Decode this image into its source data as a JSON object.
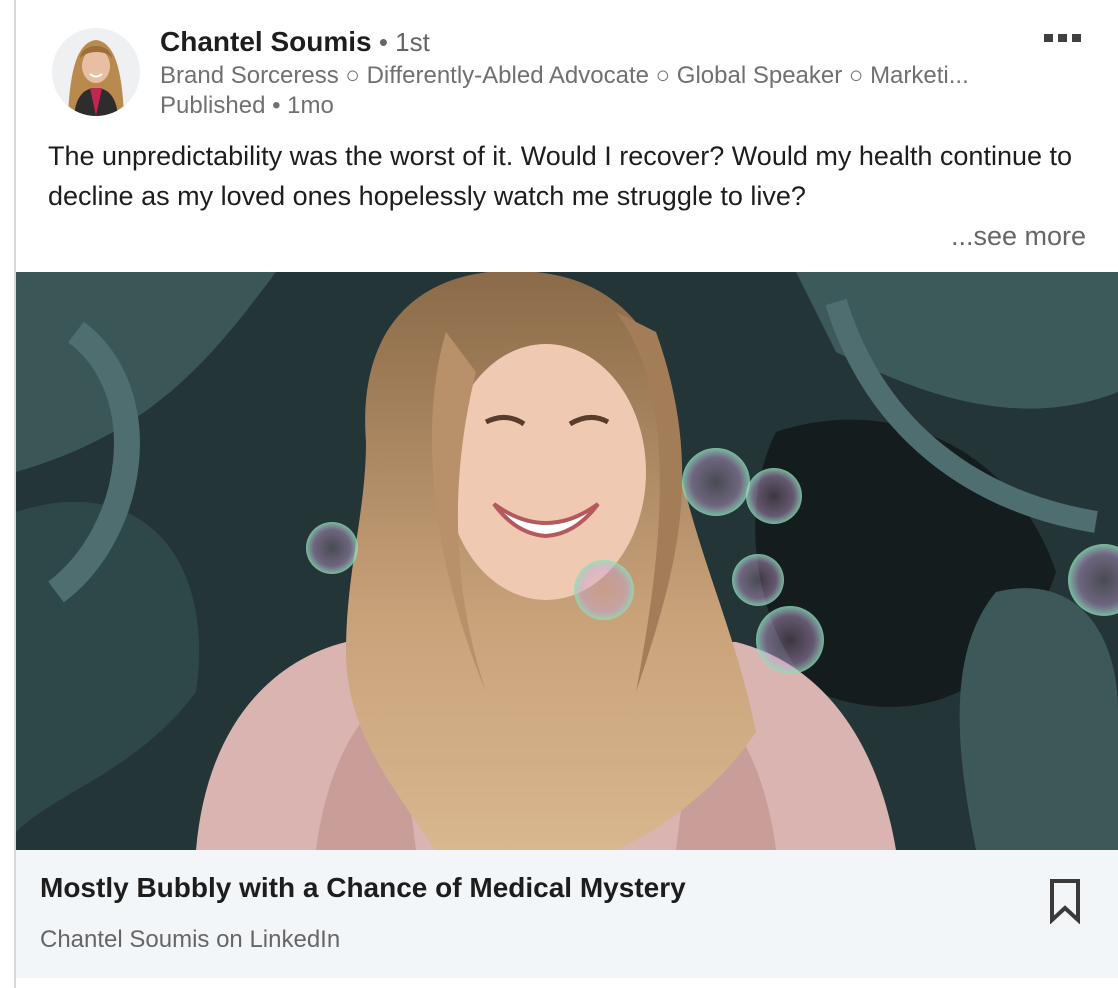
{
  "post": {
    "author_name": "Chantel Soumis",
    "degree": " • 1st",
    "headline": "Brand Sorceress ○ Differently-Abled Advocate ○ Global Speaker ○ Marketi...",
    "meta": "Published • 1mo",
    "text": "The unpredictability was the worst of it. Would I recover? Would my health continue to decline as my loved ones hopelessly watch me struggle to live?",
    "see_more": "...see more"
  },
  "article": {
    "title": "Mostly Bubbly with a Chance of Medical Mystery",
    "source": "Chantel Soumis on LinkedIn"
  },
  "icons": {
    "overflow": "more-horizontal-icon",
    "bookmark": "bookmark-icon"
  },
  "colors": {
    "text_primary": "#1d1d1d",
    "text_secondary": "#707070",
    "footer_bg": "#f3f6f8"
  }
}
